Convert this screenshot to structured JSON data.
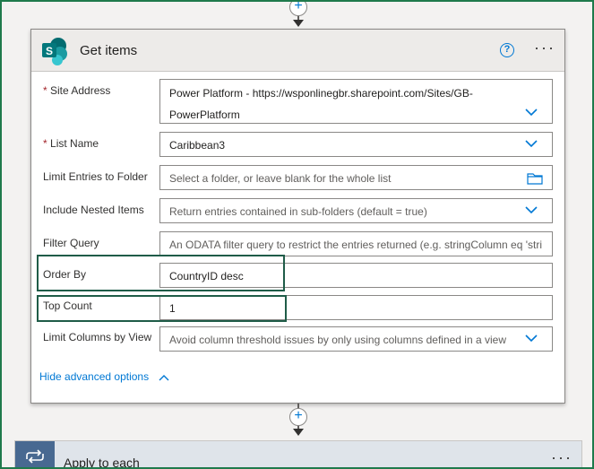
{
  "card": {
    "title": "Get items",
    "connector_icon": "sharepoint-logo-icon",
    "help_icon": "help-icon",
    "more_icon": "more-options-icon"
  },
  "fields": {
    "site_address": {
      "label": "Site Address",
      "required_mark": "*",
      "value_line1": "Power Platform - https://wsponlinegbr.sharepoint.com/Sites/GB-",
      "value_line2": "PowerPlatform"
    },
    "list_name": {
      "label": "List Name",
      "required_mark": "*",
      "value": "Caribbean3"
    },
    "limit_entries": {
      "label": "Limit Entries to Folder",
      "placeholder": "Select a folder, or leave blank for the whole list"
    },
    "include_nested": {
      "label": "Include Nested Items",
      "placeholder": "Return entries contained in sub-folders (default = true)"
    },
    "filter_query": {
      "label": "Filter Query",
      "placeholder": "An ODATA filter query to restrict the entries returned (e.g. stringColumn eq 'stri"
    },
    "order_by": {
      "label": "Order By",
      "value": "CountryID desc"
    },
    "top_count": {
      "label": "Top Count",
      "value": "1"
    },
    "limit_columns": {
      "label": "Limit Columns by View",
      "placeholder": "Avoid column threshold issues by only using columns defined in a view"
    }
  },
  "advanced_toggle": "Hide advanced options",
  "next_action": {
    "title": "Apply to each",
    "icon": "loop-icon"
  },
  "colors": {
    "accent": "#0078d4",
    "highlight_border": "#1f5c48",
    "required": "#a4262c",
    "apply_icon_bg": "#486991"
  }
}
